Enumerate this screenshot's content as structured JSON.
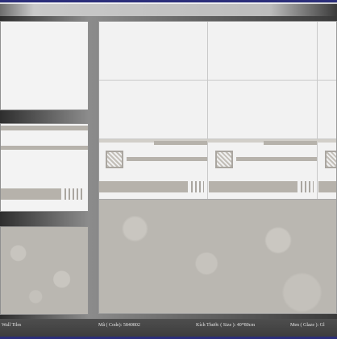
{
  "caption": {
    "category": "Wall Tiles",
    "code": "Mã ( Code): 5840802",
    "size": "Kích Thước ( Size ): 40*80cm",
    "finish": "Men ( Glaze ): Gl"
  }
}
